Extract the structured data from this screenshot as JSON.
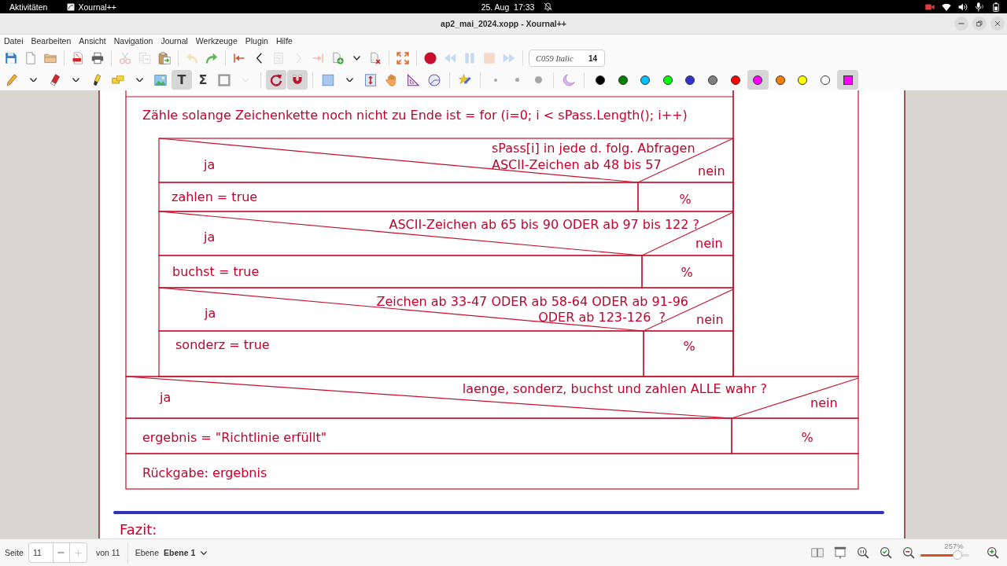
{
  "top_bar": {
    "activities": "Aktivitäten",
    "app": "Xournal++",
    "clock": "25. Aug  17:33"
  },
  "window": {
    "title": "ap2_mai_2024.xopp - Xournal++"
  },
  "menu": [
    "Datei",
    "Bearbeiten",
    "Ansicht",
    "Navigation",
    "Journal",
    "Werkzeuge",
    "Plugin",
    "Hilfe"
  ],
  "toolbar_1": [
    {
      "disabled": false
    },
    {
      "disabled": false
    },
    {
      "disabled": false
    },
    {
      "disabled": false
    },
    {
      "disabled": false
    },
    {
      "disabled": true
    },
    {
      "disabled": true
    },
    {
      "disabled": false
    },
    {
      "disabled": true
    },
    {
      "disabled": false
    },
    {
      "disabled": false
    },
    {
      "disabled": false
    },
    {
      "disabled": true
    },
    {
      "disabled": true
    },
    {
      "disabled": true
    },
    {
      "disabled": false
    },
    {
      "disabled": false
    },
    {
      "disabled": false
    },
    {
      "disabled": false
    },
    {
      "disabled": false
    },
    {
      "disabled": true
    },
    {
      "disabled": true
    },
    {
      "disabled": true
    },
    {
      "disabled": true
    }
  ],
  "font_button": {
    "font": "C059 Italic",
    "size": "14"
  },
  "toolbar_2": [
    {
      "selected": false,
      "disabled": false
    },
    {
      "selected": false,
      "disabled": false
    },
    {
      "selected": false,
      "disabled": false
    },
    {
      "selected": false,
      "disabled": false
    },
    {
      "selected": false,
      "disabled": false
    },
    {
      "selected": false,
      "disabled": false
    },
    {
      "selected": false,
      "disabled": false
    },
    {
      "selected": false,
      "disabled": false
    },
    {
      "label": "T",
      "selected": true,
      "disabled": false
    },
    {
      "label": "Σ",
      "selected": false,
      "disabled": false
    },
    {
      "selected": false,
      "disabled": false
    },
    {
      "selected": false,
      "disabled": true
    },
    {
      "selected": true,
      "disabled": false
    },
    {
      "selected": true,
      "disabled": false
    },
    {
      "selected": false,
      "disabled": false
    },
    {
      "selected": false,
      "disabled": false
    },
    {
      "selected": false,
      "disabled": false
    },
    {
      "selected": false,
      "disabled": false
    },
    {
      "selected": false,
      "disabled": false
    },
    {
      "selected": false,
      "disabled": false
    },
    {
      "selected": false,
      "disabled": false
    },
    {
      "selected": false,
      "disabled": false
    },
    {
      "selected": false,
      "disabled": false
    },
    {
      "selected": false,
      "disabled": false
    },
    {
      "selected": false,
      "disabled": false
    }
  ],
  "palette": [
    {
      "color": "#000000",
      "selected": false
    },
    {
      "color": "#008000",
      "selected": false
    },
    {
      "color": "#00c0ff",
      "selected": false
    },
    {
      "color": "#00ff00",
      "selected": false
    },
    {
      "color": "#3333cc",
      "selected": false
    },
    {
      "color": "#808080",
      "selected": false
    },
    {
      "color": "#ff0000",
      "selected": false
    },
    {
      "color": "#ff00ff",
      "selected": true
    },
    {
      "color": "#ff8000",
      "selected": false
    },
    {
      "color": "#ffff00",
      "selected": false
    },
    {
      "color": "#ffffff",
      "selected": false
    }
  ],
  "color_picker": {
    "selected": true
  },
  "page": {
    "structogram": {
      "loop_header": "Zähle solange Zeichenkette noch nicht zu Ende ist = for (i=0; i < sPass.Length(); i++)",
      "decisions": [
        {
          "condition": [
            "sPass[i] in jede d. folg. Abfragen",
            "ASCII-Zeichen ab 48 bis 57"
          ],
          "yes": "ja",
          "no": "nein",
          "action": "zahlen = true",
          "alternative": "%"
        },
        {
          "condition": [
            "ASCII-Zeichen ab 65 bis 90 ODER ab 97 bis 122 ?"
          ],
          "yes": "ja",
          "no": "nein",
          "action": "buchst = true",
          "alternative": "%"
        },
        {
          "condition": [
            "Zeichen ab 33-47 ODER ab 58-64 ODER ab 91-96",
            "ODER ab 123-126  ?"
          ],
          "yes": "ja",
          "no": "nein",
          "action": "sonderz = true",
          "alternative": "%"
        }
      ],
      "final_decision": {
        "condition": [
          "laenge, sonderz, buchst und zahlen ALLE wahr ?"
        ],
        "yes": "ja",
        "no": "nein",
        "action": "ergebnis = \"Richtlinie erfüllt\"",
        "alternative": "%"
      },
      "return": "Rückgabe: ergebnis"
    },
    "heading": "Fazit:"
  },
  "status_bar": {
    "page_label": "Seite",
    "page": "11",
    "buttons": [
      {
        "disabled": false
      },
      {
        "disabled": true
      }
    ],
    "page_count": "von 11",
    "layer_label": "Ebene",
    "layer": "Ebene 1",
    "zoom": "257%",
    "zoom_slider": {
      "level": 0.76
    }
  }
}
